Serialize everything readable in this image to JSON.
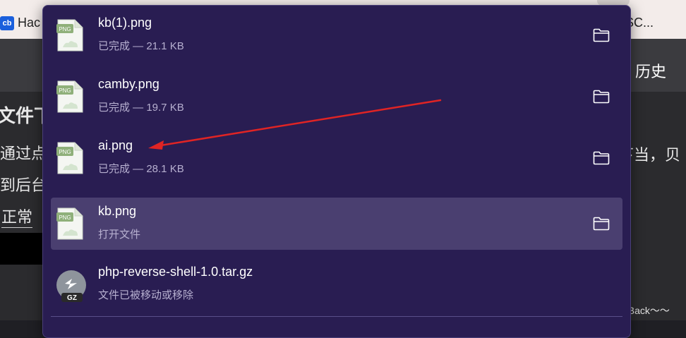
{
  "background": {
    "bookmark_left_icon": "cb",
    "bookmark_left": "Hac",
    "bookmark_right": "SC...",
    "nav_history": "历史",
    "heading_fragment": "文件下",
    "line1_fragment": "通过点",
    "line2_fragment": "到后台",
    "line3_fragment": "正常",
    "right_fragment": "下当，贝",
    "watermark": "CSDN @Back～～"
  },
  "downloads": [
    {
      "name": "kb(1).png",
      "status": "已完成 — 21.1 KB",
      "icon": "png-file-icon",
      "icon_label": "PNG"
    },
    {
      "name": "camby.png",
      "status": "已完成 — 19.7 KB",
      "icon": "png-file-icon",
      "icon_label": "PNG"
    },
    {
      "name": "ai.png",
      "status": "已完成 — 28.1 KB",
      "icon": "png-file-icon",
      "icon_label": "PNG"
    },
    {
      "name": "kb.png",
      "status": "打开文件",
      "icon": "png-file-icon",
      "icon_label": "PNG"
    },
    {
      "name": "php-reverse-shell-1.0.tar.gz",
      "status": "文件已被移动或移除",
      "icon": "gz-archive-icon",
      "icon_label": "GZ"
    }
  ],
  "colors": {
    "panel_bg": "#291d52",
    "hover_bg": "#4a3f70",
    "arrow": "#e02424"
  }
}
